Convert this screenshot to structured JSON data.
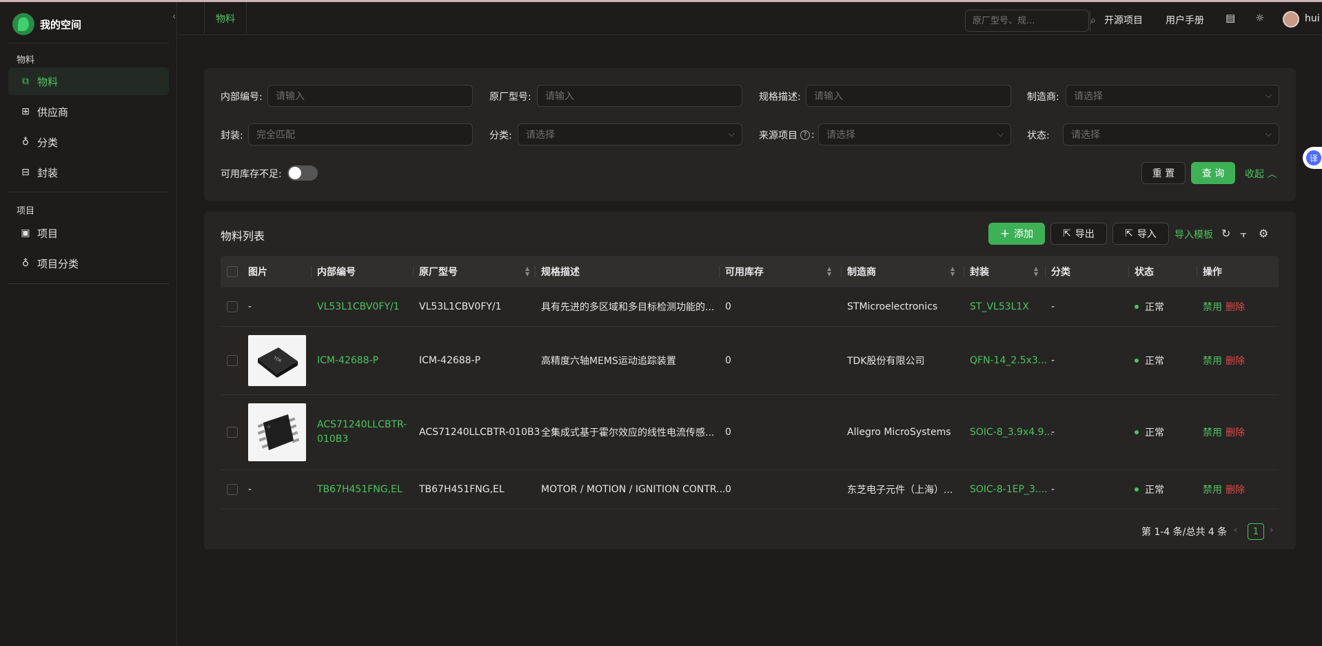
{
  "app": {
    "title": "我的空间"
  },
  "sidebar": {
    "sections": [
      {
        "title": "物料",
        "items": [
          {
            "label": "物料",
            "icon": "material-icon",
            "active": true
          },
          {
            "label": "供应商",
            "icon": "supplier-icon"
          },
          {
            "label": "分类",
            "icon": "category-icon"
          },
          {
            "label": "封装",
            "icon": "package-icon"
          }
        ]
      },
      {
        "title": "项目",
        "items": [
          {
            "label": "项目",
            "icon": "project-icon"
          },
          {
            "label": "项目分类",
            "icon": "project-category-icon"
          }
        ]
      }
    ]
  },
  "topbar": {
    "tab": "物料",
    "search_placeholder": "原厂型号、规...",
    "links": {
      "open_source": "开源项目",
      "manual": "用户手册"
    },
    "user": "hui"
  },
  "filters": {
    "internal_no": {
      "label": "内部编号:",
      "placeholder": "请输入"
    },
    "mfr_part": {
      "label": "原厂型号:",
      "placeholder": "请输入"
    },
    "spec": {
      "label": "规格描述:",
      "placeholder": "请输入"
    },
    "manufacturer": {
      "label": "制造商:",
      "placeholder": "请选择"
    },
    "package": {
      "label": "封装:",
      "placeholder": "完全匹配"
    },
    "category": {
      "label": "分类:",
      "placeholder": "请选择"
    },
    "source_project": {
      "label": "来源项目",
      "placeholder": "请选择"
    },
    "status": {
      "label": "状态:",
      "placeholder": "请选择"
    },
    "low_stock": {
      "label": "可用库存不足:"
    },
    "reset": "重 置",
    "query": "查 询",
    "collapse": "收起"
  },
  "list": {
    "title": "物料列表",
    "toolbar": {
      "add": "添加",
      "export": "导出",
      "import": "导入",
      "template": "导入模板"
    },
    "columns": [
      "图片",
      "内部编号",
      "原厂型号",
      "规格描述",
      "可用库存",
      "制造商",
      "封装",
      "分类",
      "状态",
      "操作"
    ],
    "rows": [
      {
        "image": "-",
        "internal_no": "VL53L1CBV0FY/1",
        "mfr_part": "VL53L1CBV0FY/1",
        "spec": "具有先进的多区域和多目标检测功能的...",
        "stock": "0",
        "manufacturer": "STMicroelectronics",
        "package": "ST_VL53L1X",
        "category": "-",
        "status": "正常",
        "disable": "禁用",
        "delete": "删除"
      },
      {
        "image": "chip-qfn",
        "internal_no": "ICM-42688-P",
        "mfr_part": "ICM-42688-P",
        "spec": "高精度六轴MEMS运动追踪装置",
        "stock": "0",
        "manufacturer": "TDK股份有限公司",
        "package": "QFN-14_2.5x3...",
        "category": "-",
        "status": "正常",
        "disable": "禁用",
        "delete": "删除"
      },
      {
        "image": "chip-soic",
        "internal_no": "ACS71240LLCBTR-010B3",
        "mfr_part": "ACS71240LLCBTR-010B3",
        "spec": "全集成式基于霍尔效应的线性电流传感...",
        "stock": "0",
        "manufacturer": "Allegro MicroSystems",
        "package": "SOIC-8_3.9x4.9...",
        "category": "-",
        "status": "正常",
        "disable": "禁用",
        "delete": "删除"
      },
      {
        "image": "-",
        "internal_no": "TB67H451FNG,EL",
        "mfr_part": "TB67H451FNG,EL",
        "spec": "MOTOR / MOTION / IGNITION CONTR...",
        "stock": "0",
        "manufacturer": "东芝电子元件（上海）...",
        "package": "SOIC-8-1EP_3....",
        "category": "-",
        "status": "正常",
        "disable": "禁用",
        "delete": "删除"
      }
    ],
    "pagination": {
      "summary": "第 1-4 条/总共 4 条",
      "current": "1"
    }
  },
  "translate": "译",
  "colors": {
    "accent": "#4cc35f",
    "primary_button": "#3eb157",
    "danger": "#e04848",
    "background": "#1d1c1a",
    "card": "#262523"
  }
}
